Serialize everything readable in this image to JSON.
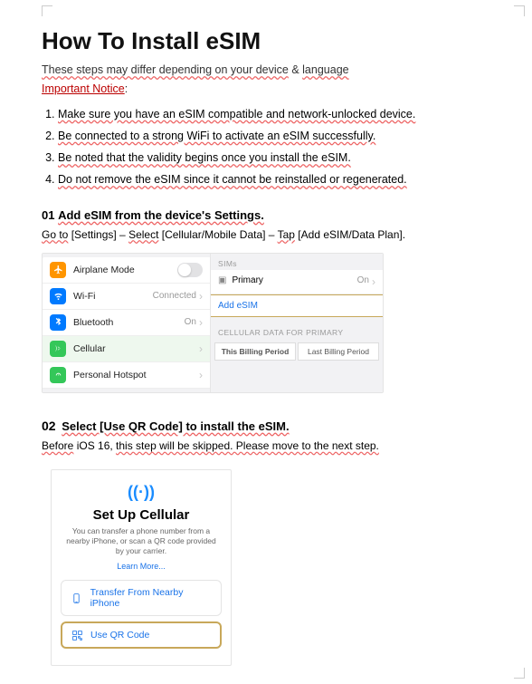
{
  "title": "How To Install eSIM",
  "intro": {
    "p1_a": "These steps may differ depending on your device",
    "p1_amp": " & ",
    "p1_b": "language",
    "p2": "Important Notice",
    "p2_colon": ":"
  },
  "notices": {
    "n1": "Make sure you have an eSIM compatible and network-unlocked device.",
    "n2": "Be connected to a strong WiFi to activate an eSIM successfully.",
    "n3": "Be noted that the validity begins once you install the eSIM.",
    "n4": "Do not remove the eSIM since it cannot be reinstalled or regenerated."
  },
  "step01": {
    "num": "01",
    "head": "Add eSIM from the device's Settings.",
    "sub_a": "Go to",
    "sub_b": " [Settings] – ",
    "sub_c": "Select",
    "sub_d": " [Cellular/Mobile Data] – ",
    "sub_e": "Tap",
    "sub_f": " [Add eSIM/Data Plan]"
  },
  "shot1": {
    "airplane": "Airplane Mode",
    "wifi": "Wi-Fi",
    "wifi_status": "Connected",
    "bluetooth": "Bluetooth",
    "bt_status": "On",
    "cellular": "Cellular",
    "hotspot": "Personal Hotspot",
    "sims_hdr": "SIMs",
    "primary": "Primary",
    "primary_status": "On",
    "add_esim": "Add eSIM",
    "cell_data_hdr": "CELLULAR DATA FOR PRIMARY",
    "tab1": "This Billing Period",
    "tab2": "Last Billing Period"
  },
  "step02": {
    "num": "02",
    "head": "Select [Use QR Code] to install the eSIM.",
    "sub_a": "Before",
    "sub_b": " iOS 16, ",
    "sub_c": "this step will be skipped. Please move to the next step."
  },
  "shot2": {
    "antenna": "((·))",
    "title": "Set Up Cellular",
    "desc": "You can transfer a phone number from a nearby iPhone, or scan a QR code provided by your carrier.",
    "learn": "Learn More...",
    "opt1": "Transfer From Nearby iPhone",
    "opt2": "Use QR Code"
  }
}
